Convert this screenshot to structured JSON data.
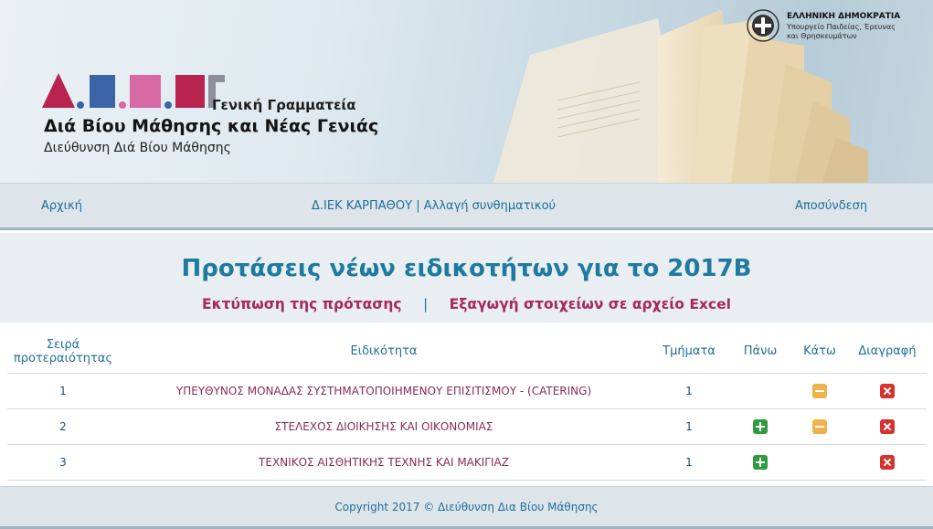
{
  "header": {
    "logo_letters": [
      "Δ",
      "Β",
      "Μ",
      "Ν",
      "Γ"
    ],
    "logo_line1": "Γενική Γραμματεία",
    "logo_line2": "Διά Βίου Μάθησης και Νέας Γενιάς",
    "logo_line3": "Διεύθυνση Διά Βίου Μάθησης",
    "gov_title": "ΕΛΛΗΝΙΚΗ ΔΗΜΟΚΡΑΤΙΑ",
    "gov_line1": "Υπουργείο Παιδείας, Έρευνας",
    "gov_line2": "και Θρησκευμάτων",
    "colors": {
      "logo_red": "#b8234f",
      "logo_blue": "#3a63a8",
      "logo_pink": "#d76aa5",
      "logo_grey": "#8f8f9b"
    }
  },
  "nav": {
    "home": "Αρχική",
    "school": "Δ.ΙΕΚ ΚΑΡΠΑΘΟΥ",
    "separator": "|",
    "change_password": "Αλλαγή συνθηματικού",
    "logout": "Αποσύνδεση"
  },
  "main": {
    "title": "Προτάσεις νέων ειδικοτήτων για το 2017Β",
    "print_link": "Εκτύπωση της πρότασης",
    "divider": "|",
    "export_link": "Εξαγωγή στοιχείων σε αρχείο Excel"
  },
  "table": {
    "headers": {
      "priority": "Σειρά προτεραιότητας",
      "specialty": "Ειδικότητα",
      "sections": "Τμήματα",
      "up": "Πάνω",
      "down": "Κάτω",
      "delete": "Διαγραφή"
    },
    "rows": [
      {
        "priority": "1",
        "specialty": "ΥΠΕΥΘΥΝΟΣ ΜΟΝΑΔΑΣ ΣΥΣΤΗΜΑΤΟΠΟΙΗΜΕΝΟΥ ΕΠΙΣΙΤΙΣΜΟΥ - (CATERING)",
        "sections": "1",
        "up": false,
        "down": true,
        "delete": true
      },
      {
        "priority": "2",
        "specialty": "ΣΤΕΛΕΧΟΣ ΔΙΟΙΚΗΣΗΣ ΚΑΙ ΟΙΚΟΝΟΜΙΑΣ",
        "sections": "1",
        "up": true,
        "down": true,
        "delete": true
      },
      {
        "priority": "3",
        "specialty": "ΤΕΧΝΙΚΟΣ ΑΙΣΘΗΤΙΚΗΣ ΤΕΧΝΗΣ ΚΑΙ ΜΑΚΙΓΙΑΖ",
        "sections": "1",
        "up": true,
        "down": false,
        "delete": true
      }
    ],
    "icons": {
      "up": "plus-icon",
      "down": "minus-icon",
      "delete": "delete-x-icon"
    }
  },
  "footer": {
    "copyright": "Copyright 2017 © Διεύθυνση Δια Βίου Μάθησης"
  }
}
